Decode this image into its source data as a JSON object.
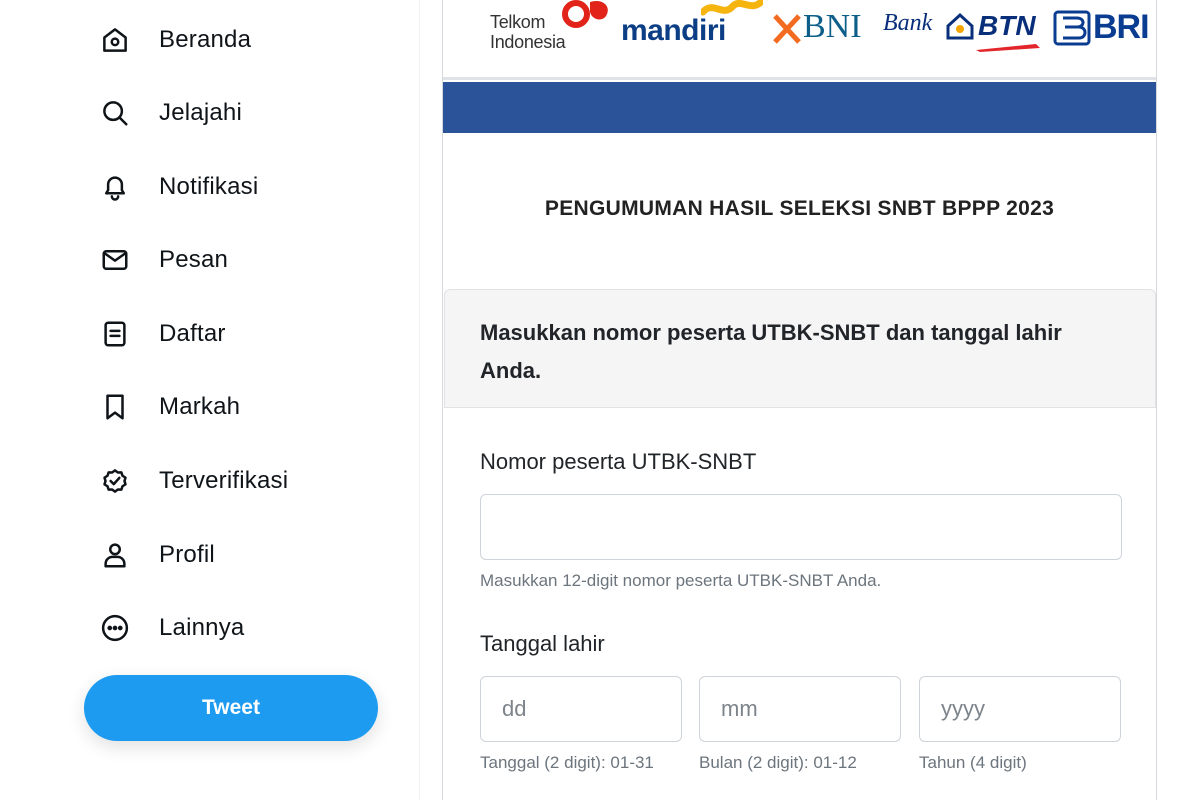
{
  "sidebar": {
    "items": [
      {
        "label": "Beranda",
        "icon": "home-icon"
      },
      {
        "label": "Jelajahi",
        "icon": "search-icon"
      },
      {
        "label": "Notifikasi",
        "icon": "bell-icon"
      },
      {
        "label": "Pesan",
        "icon": "mail-icon"
      },
      {
        "label": "Daftar",
        "icon": "list-icon"
      },
      {
        "label": "Markah",
        "icon": "bookmark-icon"
      },
      {
        "label": "Terverifikasi",
        "icon": "verified-badge-icon"
      },
      {
        "label": "Profil",
        "icon": "user-icon"
      },
      {
        "label": "Lainnya",
        "icon": "more-circle-icon"
      }
    ],
    "tweet_label": "Tweet"
  },
  "logos": {
    "telkom_line1": "Telkom",
    "telkom_line2": "Indonesia",
    "mandiri": "mandiri",
    "bni": "BNI",
    "btn_bank": "Bank",
    "btn": "BTN",
    "bri": "BRI"
  },
  "announcement": {
    "title": "PENGUMUMAN HASIL SELEKSI SNBT BPPP 2023",
    "instruction": "Masukkan nomor peserta UTBK-SNBT dan tanggal lahir Anda."
  },
  "form": {
    "participant_label": "Nomor peserta UTBK-SNBT",
    "participant_value": "",
    "participant_help": "Masukkan 12-digit nomor peserta UTBK-SNBT Anda.",
    "dob_label": "Tanggal lahir",
    "day_placeholder": "dd",
    "month_placeholder": "mm",
    "year_placeholder": "yyyy",
    "day_help": "Tanggal (2 digit): 01-31",
    "month_help": "Bulan (2 digit): 01-12",
    "year_help": "Tahun (4 digit)"
  },
  "colors": {
    "tweet_button": "#1d9bf0",
    "banner_bar": "#2a539a"
  }
}
